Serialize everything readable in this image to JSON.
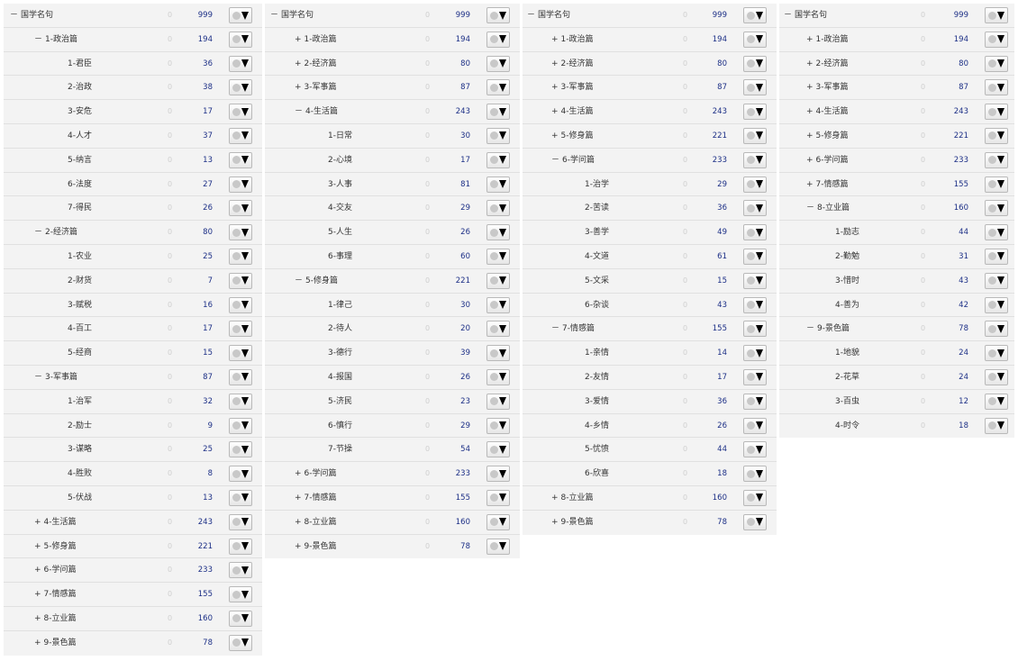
{
  "panels": [
    {
      "rows": [
        {
          "marker": "－",
          "text": "国学名句",
          "level": 0,
          "zero": "0",
          "count": "999",
          "ctype": "root"
        },
        {
          "marker": "－",
          "text": "1-政治篇",
          "level": 1,
          "zero": "0",
          "count": "194",
          "ctype": "cat"
        },
        {
          "marker": "",
          "text": "1-君臣",
          "level": 2,
          "zero": "0",
          "count": "36",
          "ctype": "leaf"
        },
        {
          "marker": "",
          "text": "2-治政",
          "level": 2,
          "zero": "0",
          "count": "38",
          "ctype": "leaf"
        },
        {
          "marker": "",
          "text": "3-安危",
          "level": 2,
          "zero": "0",
          "count": "17",
          "ctype": "leaf"
        },
        {
          "marker": "",
          "text": "4-人才",
          "level": 2,
          "zero": "0",
          "count": "37",
          "ctype": "leaf"
        },
        {
          "marker": "",
          "text": "5-纳言",
          "level": 2,
          "zero": "0",
          "count": "13",
          "ctype": "leaf"
        },
        {
          "marker": "",
          "text": "6-法度",
          "level": 2,
          "zero": "0",
          "count": "27",
          "ctype": "leaf"
        },
        {
          "marker": "",
          "text": "7-得民",
          "level": 2,
          "zero": "0",
          "count": "26",
          "ctype": "leaf"
        },
        {
          "marker": "－",
          "text": "2-经济篇",
          "level": 1,
          "zero": "0",
          "count": "80",
          "ctype": "cat"
        },
        {
          "marker": "",
          "text": "1-农业",
          "level": 2,
          "zero": "0",
          "count": "25",
          "ctype": "leaf"
        },
        {
          "marker": "",
          "text": "2-财货",
          "level": 2,
          "zero": "0",
          "count": "7",
          "ctype": "leaf"
        },
        {
          "marker": "",
          "text": "3-赋税",
          "level": 2,
          "zero": "0",
          "count": "16",
          "ctype": "leaf"
        },
        {
          "marker": "",
          "text": "4-百工",
          "level": 2,
          "zero": "0",
          "count": "17",
          "ctype": "leaf"
        },
        {
          "marker": "",
          "text": "5-经商",
          "level": 2,
          "zero": "0",
          "count": "15",
          "ctype": "leaf"
        },
        {
          "marker": "－",
          "text": "3-军事篇",
          "level": 1,
          "zero": "0",
          "count": "87",
          "ctype": "cat"
        },
        {
          "marker": "",
          "text": "1-治军",
          "level": 2,
          "zero": "0",
          "count": "32",
          "ctype": "leaf"
        },
        {
          "marker": "",
          "text": "2-励士",
          "level": 2,
          "zero": "0",
          "count": "9",
          "ctype": "leaf"
        },
        {
          "marker": "",
          "text": "3-谋略",
          "level": 2,
          "zero": "0",
          "count": "25",
          "ctype": "leaf"
        },
        {
          "marker": "",
          "text": "4-胜败",
          "level": 2,
          "zero": "0",
          "count": "8",
          "ctype": "leaf"
        },
        {
          "marker": "",
          "text": "5-伏战",
          "level": 2,
          "zero": "0",
          "count": "13",
          "ctype": "leaf"
        },
        {
          "marker": "+",
          "text": "4-生活篇",
          "level": 1,
          "zero": "0",
          "count": "243",
          "ctype": "cat"
        },
        {
          "marker": "+",
          "text": "5-修身篇",
          "level": 1,
          "zero": "0",
          "count": "221",
          "ctype": "cat"
        },
        {
          "marker": "+",
          "text": "6-学问篇",
          "level": 1,
          "zero": "0",
          "count": "233",
          "ctype": "cat"
        },
        {
          "marker": "+",
          "text": "7-情感篇",
          "level": 1,
          "zero": "0",
          "count": "155",
          "ctype": "cat"
        },
        {
          "marker": "+",
          "text": "8-立业篇",
          "level": 1,
          "zero": "0",
          "count": "160",
          "ctype": "cat"
        },
        {
          "marker": "+",
          "text": "9-景色篇",
          "level": 1,
          "zero": "0",
          "count": "78",
          "ctype": "cat"
        }
      ]
    },
    {
      "rows": [
        {
          "marker": "－",
          "text": "国学名句",
          "level": 0,
          "zero": "0",
          "count": "999",
          "ctype": "root"
        },
        {
          "marker": "+",
          "text": "1-政治篇",
          "level": 1,
          "zero": "0",
          "count": "194",
          "ctype": "cat"
        },
        {
          "marker": "+",
          "text": "2-经济篇",
          "level": 1,
          "zero": "0",
          "count": "80",
          "ctype": "cat"
        },
        {
          "marker": "+",
          "text": "3-军事篇",
          "level": 1,
          "zero": "0",
          "count": "87",
          "ctype": "cat"
        },
        {
          "marker": "－",
          "text": "4-生活篇",
          "level": 1,
          "zero": "0",
          "count": "243",
          "ctype": "cat"
        },
        {
          "marker": "",
          "text": "1-日常",
          "level": 2,
          "zero": "0",
          "count": "30",
          "ctype": "leaf"
        },
        {
          "marker": "",
          "text": "2-心境",
          "level": 2,
          "zero": "0",
          "count": "17",
          "ctype": "leaf"
        },
        {
          "marker": "",
          "text": "3-人事",
          "level": 2,
          "zero": "0",
          "count": "81",
          "ctype": "leaf"
        },
        {
          "marker": "",
          "text": "4-交友",
          "level": 2,
          "zero": "0",
          "count": "29",
          "ctype": "leaf"
        },
        {
          "marker": "",
          "text": "5-人生",
          "level": 2,
          "zero": "0",
          "count": "26",
          "ctype": "leaf"
        },
        {
          "marker": "",
          "text": "6-事理",
          "level": 2,
          "zero": "0",
          "count": "60",
          "ctype": "leaf"
        },
        {
          "marker": "－",
          "text": "5-修身篇",
          "level": 1,
          "zero": "0",
          "count": "221",
          "ctype": "cat"
        },
        {
          "marker": "",
          "text": "1-律己",
          "level": 2,
          "zero": "0",
          "count": "30",
          "ctype": "leaf"
        },
        {
          "marker": "",
          "text": "2-待人",
          "level": 2,
          "zero": "0",
          "count": "20",
          "ctype": "leaf"
        },
        {
          "marker": "",
          "text": "3-德行",
          "level": 2,
          "zero": "0",
          "count": "39",
          "ctype": "leaf"
        },
        {
          "marker": "",
          "text": "4-报国",
          "level": 2,
          "zero": "0",
          "count": "26",
          "ctype": "leaf"
        },
        {
          "marker": "",
          "text": "5-济民",
          "level": 2,
          "zero": "0",
          "count": "23",
          "ctype": "leaf"
        },
        {
          "marker": "",
          "text": "6-慎行",
          "level": 2,
          "zero": "0",
          "count": "29",
          "ctype": "leaf"
        },
        {
          "marker": "",
          "text": "7-节操",
          "level": 2,
          "zero": "0",
          "count": "54",
          "ctype": "leaf"
        },
        {
          "marker": "+",
          "text": "6-学问篇",
          "level": 1,
          "zero": "0",
          "count": "233",
          "ctype": "cat"
        },
        {
          "marker": "+",
          "text": "7-情感篇",
          "level": 1,
          "zero": "0",
          "count": "155",
          "ctype": "cat"
        },
        {
          "marker": "+",
          "text": "8-立业篇",
          "level": 1,
          "zero": "0",
          "count": "160",
          "ctype": "cat"
        },
        {
          "marker": "+",
          "text": "9-景色篇",
          "level": 1,
          "zero": "0",
          "count": "78",
          "ctype": "cat"
        }
      ]
    },
    {
      "rows": [
        {
          "marker": "－",
          "text": "国学名句",
          "level": 0,
          "zero": "0",
          "count": "999",
          "ctype": "root"
        },
        {
          "marker": "+",
          "text": "1-政治篇",
          "level": 1,
          "zero": "0",
          "count": "194",
          "ctype": "cat"
        },
        {
          "marker": "+",
          "text": "2-经济篇",
          "level": 1,
          "zero": "0",
          "count": "80",
          "ctype": "cat"
        },
        {
          "marker": "+",
          "text": "3-军事篇",
          "level": 1,
          "zero": "0",
          "count": "87",
          "ctype": "cat"
        },
        {
          "marker": "+",
          "text": "4-生活篇",
          "level": 1,
          "zero": "0",
          "count": "243",
          "ctype": "cat"
        },
        {
          "marker": "+",
          "text": "5-修身篇",
          "level": 1,
          "zero": "0",
          "count": "221",
          "ctype": "cat"
        },
        {
          "marker": "－",
          "text": "6-学问篇",
          "level": 1,
          "zero": "0",
          "count": "233",
          "ctype": "cat"
        },
        {
          "marker": "",
          "text": "1-治学",
          "level": 2,
          "zero": "0",
          "count": "29",
          "ctype": "leaf"
        },
        {
          "marker": "",
          "text": "2-苦读",
          "level": 2,
          "zero": "0",
          "count": "36",
          "ctype": "leaf"
        },
        {
          "marker": "",
          "text": "3-善学",
          "level": 2,
          "zero": "0",
          "count": "49",
          "ctype": "leaf"
        },
        {
          "marker": "",
          "text": "4-文道",
          "level": 2,
          "zero": "0",
          "count": "61",
          "ctype": "leaf"
        },
        {
          "marker": "",
          "text": "5-文采",
          "level": 2,
          "zero": "0",
          "count": "15",
          "ctype": "leaf"
        },
        {
          "marker": "",
          "text": "6-杂谈",
          "level": 2,
          "zero": "0",
          "count": "43",
          "ctype": "leaf"
        },
        {
          "marker": "－",
          "text": "7-情感篇",
          "level": 1,
          "zero": "0",
          "count": "155",
          "ctype": "cat"
        },
        {
          "marker": "",
          "text": "1-亲情",
          "level": 2,
          "zero": "0",
          "count": "14",
          "ctype": "leaf"
        },
        {
          "marker": "",
          "text": "2-友情",
          "level": 2,
          "zero": "0",
          "count": "17",
          "ctype": "leaf"
        },
        {
          "marker": "",
          "text": "3-爱情",
          "level": 2,
          "zero": "0",
          "count": "36",
          "ctype": "leaf"
        },
        {
          "marker": "",
          "text": "4-乡情",
          "level": 2,
          "zero": "0",
          "count": "26",
          "ctype": "leaf"
        },
        {
          "marker": "",
          "text": "5-忧愤",
          "level": 2,
          "zero": "0",
          "count": "44",
          "ctype": "leaf"
        },
        {
          "marker": "",
          "text": "6-欣喜",
          "level": 2,
          "zero": "0",
          "count": "18",
          "ctype": "leaf"
        },
        {
          "marker": "+",
          "text": "8-立业篇",
          "level": 1,
          "zero": "0",
          "count": "160",
          "ctype": "cat"
        },
        {
          "marker": "+",
          "text": "9-景色篇",
          "level": 1,
          "zero": "0",
          "count": "78",
          "ctype": "cat"
        }
      ]
    },
    {
      "rows": [
        {
          "marker": "－",
          "text": "国学名句",
          "level": 0,
          "zero": "0",
          "count": "999",
          "ctype": "root"
        },
        {
          "marker": "+",
          "text": "1-政治篇",
          "level": 1,
          "zero": "0",
          "count": "194",
          "ctype": "cat"
        },
        {
          "marker": "+",
          "text": "2-经济篇",
          "level": 1,
          "zero": "0",
          "count": "80",
          "ctype": "cat"
        },
        {
          "marker": "+",
          "text": "3-军事篇",
          "level": 1,
          "zero": "0",
          "count": "87",
          "ctype": "cat"
        },
        {
          "marker": "+",
          "text": "4-生活篇",
          "level": 1,
          "zero": "0",
          "count": "243",
          "ctype": "cat"
        },
        {
          "marker": "+",
          "text": "5-修身篇",
          "level": 1,
          "zero": "0",
          "count": "221",
          "ctype": "cat"
        },
        {
          "marker": "+",
          "text": "6-学问篇",
          "level": 1,
          "zero": "0",
          "count": "233",
          "ctype": "cat"
        },
        {
          "marker": "+",
          "text": "7-情感篇",
          "level": 1,
          "zero": "0",
          "count": "155",
          "ctype": "cat"
        },
        {
          "marker": "－",
          "text": "8-立业篇",
          "level": 1,
          "zero": "0",
          "count": "160",
          "ctype": "cat"
        },
        {
          "marker": "",
          "text": "1-励志",
          "level": 2,
          "zero": "0",
          "count": "44",
          "ctype": "leaf"
        },
        {
          "marker": "",
          "text": "2-勤勉",
          "level": 2,
          "zero": "0",
          "count": "31",
          "ctype": "leaf"
        },
        {
          "marker": "",
          "text": "3-惜时",
          "level": 2,
          "zero": "0",
          "count": "43",
          "ctype": "leaf"
        },
        {
          "marker": "",
          "text": "4-善为",
          "level": 2,
          "zero": "0",
          "count": "42",
          "ctype": "leaf"
        },
        {
          "marker": "－",
          "text": "9-景色篇",
          "level": 1,
          "zero": "0",
          "count": "78",
          "ctype": "cat"
        },
        {
          "marker": "",
          "text": "1-地貌",
          "level": 2,
          "zero": "0",
          "count": "24",
          "ctype": "leaf"
        },
        {
          "marker": "",
          "text": "2-花草",
          "level": 2,
          "zero": "0",
          "count": "24",
          "ctype": "leaf"
        },
        {
          "marker": "",
          "text": "3-百虫",
          "level": 2,
          "zero": "0",
          "count": "12",
          "ctype": "leaf"
        },
        {
          "marker": "",
          "text": "4-时令",
          "level": 2,
          "zero": "0",
          "count": "18",
          "ctype": "leaf"
        }
      ]
    }
  ],
  "icons": {
    "button": [
      "circle-icon",
      "dropdown-triangle-icon"
    ]
  },
  "colors": {
    "count": "#1c2f86",
    "zero": "#cfcfcf",
    "panel_bg": "#f3f3f3",
    "row_border": "#e0e0e0"
  }
}
